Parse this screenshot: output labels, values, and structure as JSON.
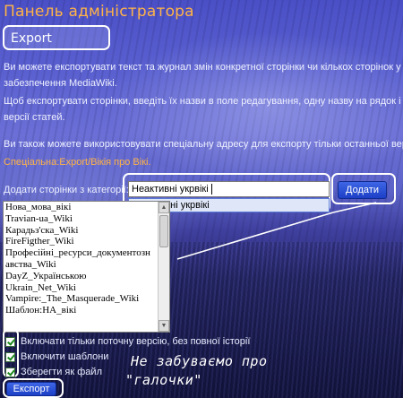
{
  "header": {
    "title": "Панель адміністратора"
  },
  "section": {
    "title": "Export"
  },
  "paragraphs": [
    "Ви можете експортувати текст та журнал змін конкретної сторінки чи кількох сторінок у XML",
    "забезпечення MediaWiki.",
    "Щоб експортувати сторінки, введіть їх назви в поле редагування, одну назву на рядок і оберіть",
    "версії статей.",
    "Ви також можете використовувати спеціальну адресу для експорту тільки останньої версії сторінок.",
    "Спеціальна:Export/Вікія про Вікі."
  ],
  "category": {
    "label": "Додати сторінки з категорії:",
    "input_value": "Неактивні укрвікі",
    "suggestion": "Неактивні укрвікі",
    "add_button": "Додати"
  },
  "pages": [
    "Нова_мова_вікі",
    "Travian-ua_Wiki",
    "Карадьз'ска_Wiki",
    "FireFigther_Wiki",
    "Професійні_ресурси_документозн",
    "авства_Wiki",
    "DayZ_Українською",
    "Ukrain_Net_Wiki",
    "Vampire:_The_Masquerade_Wiki",
    "Шаблон:НА_вікі"
  ],
  "options": [
    {
      "label": "Включати тільки поточну версію, без повної історії",
      "checked": true
    },
    {
      "label": "Включити шаблони",
      "checked": true
    },
    {
      "label": "Зберегти як файл",
      "checked": true
    }
  ],
  "export_button": "Експорт",
  "annotation": {
    "line1": "Не забуваємо про",
    "line2": "\"галочки\""
  },
  "colors": {
    "accent": "#ffb347",
    "button": "#1c3fc6",
    "highlight": "#ffffff"
  },
  "icons": {
    "scroll_up": "chevron-up-icon",
    "scroll_down": "chevron-down-icon",
    "check": "checkmark-icon"
  }
}
